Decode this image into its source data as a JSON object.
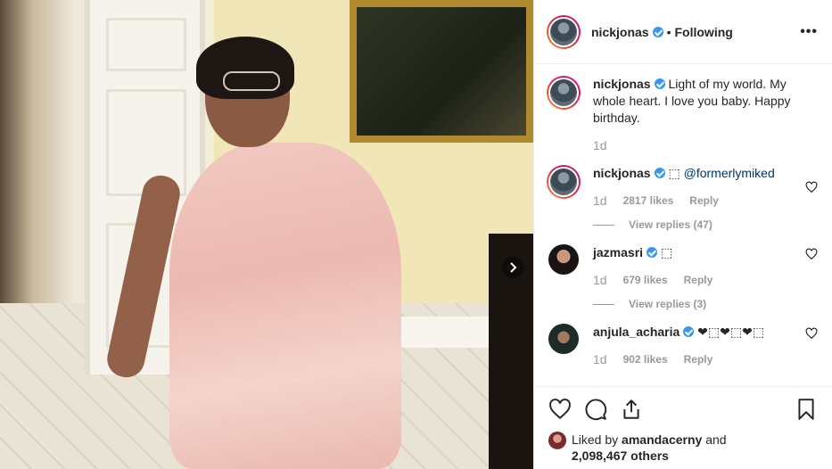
{
  "post": {
    "author": "nickjonas",
    "separator": "•",
    "follow_status": "Following",
    "more_label": "•••"
  },
  "caption": {
    "username": "nickjonas",
    "text": "Light of my world. My whole heart. I love you baby. Happy birthday.",
    "age": "1d"
  },
  "comments": [
    {
      "username": "nickjonas",
      "text_prefix": "⬚ ",
      "mention": "@formerlymiked",
      "text": "",
      "age": "1d",
      "likes": "2817 likes",
      "reply_label": "Reply",
      "view_replies": "View replies (47)"
    },
    {
      "username": "jazmasri",
      "text_prefix": "",
      "mention": "",
      "text": "⬚",
      "age": "1d",
      "likes": "679 likes",
      "reply_label": "Reply",
      "view_replies": "View replies (3)"
    },
    {
      "username": "anjula_acharia",
      "text_prefix": "",
      "mention": "",
      "text": "❤⬚❤⬚❤⬚",
      "age": "1d",
      "likes": "902 likes",
      "reply_label": "Reply",
      "view_replies": ""
    }
  ],
  "likes": {
    "prefix": "Liked by",
    "user": "amandacerny",
    "conjunction": "and",
    "count": "2,098,467 others"
  },
  "colors": {
    "verified": "#3897f0",
    "text": "#262626",
    "muted": "#999999",
    "mention": "#003569"
  },
  "icons": [
    "heart-icon",
    "comment-icon",
    "share-icon",
    "bookmark-icon",
    "chevron-right-icon",
    "more-icon"
  ]
}
